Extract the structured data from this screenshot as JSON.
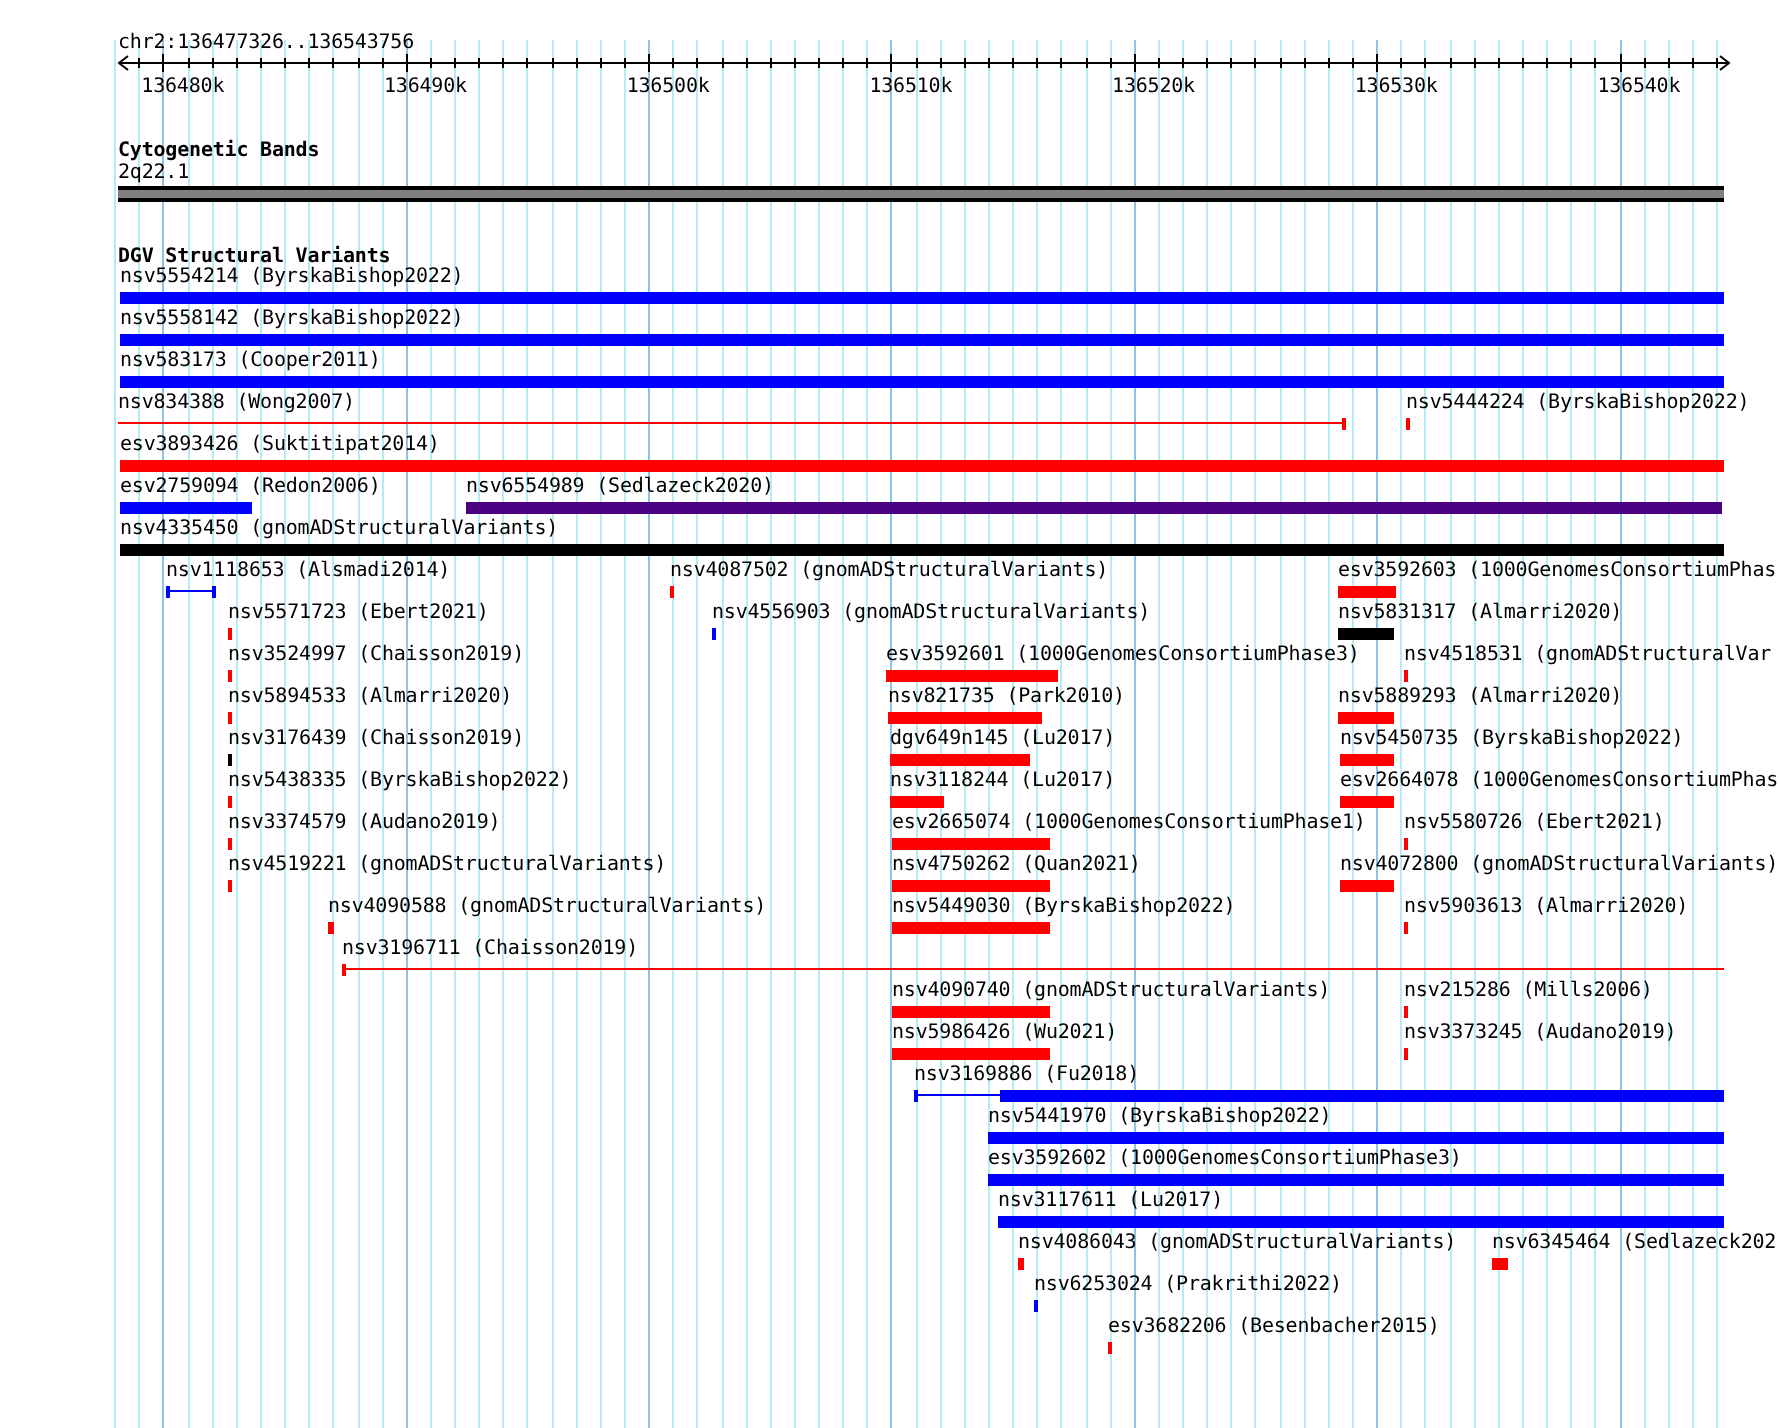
{
  "ruler": {
    "position": "chr2:136477326..136543756",
    "ticks": [
      "136480k",
      "136490k",
      "136500k",
      "136510k",
      "136520k",
      "136530k",
      "136540k"
    ]
  },
  "cytoband_track": {
    "title": "Cytogenetic Bands",
    "band": "2q22.1"
  },
  "variants_track": {
    "title": "DGV Structural Variants",
    "rows": [
      {
        "features": [
          {
            "label": "nsv5554214 (ByrskaBishop2022)",
            "kind": "block",
            "color": "#0000ff"
          }
        ]
      },
      {
        "features": [
          {
            "label": "nsv5558142 (ByrskaBishop2022)",
            "kind": "block",
            "color": "#0000ff"
          }
        ]
      },
      {
        "features": [
          {
            "label": "nsv583173 (Cooper2011)",
            "kind": "block",
            "color": "#0000ff"
          }
        ]
      },
      {
        "features": [
          {
            "label": "nsv834388 (Wong2007)",
            "kind": "line",
            "color": "#ff0000"
          },
          {
            "label": "nsv5444224 (ByrskaBishop2022)",
            "kind": "block",
            "color": "#ff0000"
          }
        ]
      },
      {
        "features": [
          {
            "label": "esv3893426 (Suktitipat2014)",
            "kind": "block",
            "color": "#ff0000"
          }
        ]
      },
      {
        "features": [
          {
            "label": "esv2759094 (Redon2006)",
            "kind": "block",
            "color": "#0000ff"
          },
          {
            "label": "nsv6554989 (Sedlazeck2020)",
            "kind": "block",
            "color": "#4b0082"
          }
        ]
      },
      {
        "features": [
          {
            "label": "nsv4335450 (gnomADStructuralVariants)",
            "kind": "block",
            "color": "#000000"
          }
        ]
      },
      {
        "features": [
          {
            "label": "nsv1118653 (Alsmadi2014)",
            "kind": "line",
            "color": "#0000ff"
          },
          {
            "label": "nsv4087502 (gnomADStructuralVariants)",
            "kind": "block",
            "color": "#ff0000"
          },
          {
            "label": "esv3592603 (1000GenomesConsortiumPhas",
            "kind": "block",
            "color": "#ff0000"
          }
        ]
      },
      {
        "features": [
          {
            "label": "nsv5571723 (Ebert2021)",
            "kind": "block",
            "color": "#ff0000"
          },
          {
            "label": "nsv4556903 (gnomADStructuralVariants)",
            "kind": "block",
            "color": "#0000ff"
          },
          {
            "label": "nsv5831317 (Almarri2020)",
            "kind": "block",
            "color": "#000000"
          }
        ]
      },
      {
        "features": [
          {
            "label": "nsv3524997 (Chaisson2019)",
            "kind": "block",
            "color": "#ff0000"
          },
          {
            "label": "esv3592601 (1000GenomesConsortiumPhase3)",
            "kind": "block",
            "color": "#ff0000"
          },
          {
            "label": "nsv4518531 (gnomADStructuralVar",
            "kind": "block",
            "color": "#ff0000"
          }
        ]
      },
      {
        "features": [
          {
            "label": "nsv5894533 (Almarri2020)",
            "kind": "block",
            "color": "#ff0000"
          },
          {
            "label": "nsv821735 (Park2010)",
            "kind": "block",
            "color": "#ff0000"
          },
          {
            "label": "nsv5889293 (Almarri2020)",
            "kind": "block",
            "color": "#ff0000"
          }
        ]
      },
      {
        "features": [
          {
            "label": "nsv3176439 (Chaisson2019)",
            "kind": "block",
            "color": "#000000"
          },
          {
            "label": "dgv649n145 (Lu2017)",
            "kind": "block",
            "color": "#ff0000"
          },
          {
            "label": "nsv5450735 (ByrskaBishop2022)",
            "kind": "block",
            "color": "#ff0000"
          }
        ]
      },
      {
        "features": [
          {
            "label": "nsv5438335 (ByrskaBishop2022)",
            "kind": "block",
            "color": "#ff0000"
          },
          {
            "label": "nsv3118244 (Lu2017)",
            "kind": "block",
            "color": "#ff0000"
          },
          {
            "label": "esv2664078 (1000GenomesConsortiumPhas",
            "kind": "block",
            "color": "#ff0000"
          }
        ]
      },
      {
        "features": [
          {
            "label": "nsv3374579 (Audano2019)",
            "kind": "block",
            "color": "#ff0000"
          },
          {
            "label": "esv2665074 (1000GenomesConsortiumPhase1)",
            "kind": "block",
            "color": "#ff0000"
          },
          {
            "label": "nsv5580726 (Ebert2021)",
            "kind": "block",
            "color": "#ff0000"
          }
        ]
      },
      {
        "features": [
          {
            "label": "nsv4519221 (gnomADStructuralVariants)",
            "kind": "block",
            "color": "#ff0000"
          },
          {
            "label": "nsv4750262 (Quan2021)",
            "kind": "block",
            "color": "#ff0000"
          },
          {
            "label": "nsv4072800 (gnomADStructuralVariants)",
            "kind": "block",
            "color": "#ff0000"
          }
        ]
      },
      {
        "features": [
          {
            "label": "nsv4090588 (gnomADStructuralVariants)",
            "kind": "block",
            "color": "#ff0000"
          },
          {
            "label": "nsv5449030 (ByrskaBishop2022)",
            "kind": "block",
            "color": "#ff0000"
          },
          {
            "label": "nsv5903613 (Almarri2020)",
            "kind": "block",
            "color": "#ff0000"
          }
        ]
      },
      {
        "features": [
          {
            "label": "nsv3196711 (Chaisson2019)",
            "kind": "line",
            "color": "#ff0000"
          }
        ]
      },
      {
        "features": [
          {
            "label": "nsv4090740 (gnomADStructuralVariants)",
            "kind": "block",
            "color": "#ff0000"
          },
          {
            "label": "nsv215286 (Mills2006)",
            "kind": "block",
            "color": "#ff0000"
          }
        ]
      },
      {
        "features": [
          {
            "label": "nsv5986426 (Wu2021)",
            "kind": "block",
            "color": "#ff0000"
          },
          {
            "label": "nsv3373245 (Audano2019)",
            "kind": "block",
            "color": "#ff0000"
          }
        ]
      },
      {
        "features": [
          {
            "label": "nsv3169886 (Fu2018)",
            "kind": "tailed",
            "color": "#0000ff"
          }
        ]
      },
      {
        "features": [
          {
            "label": "nsv5441970 (ByrskaBishop2022)",
            "kind": "block",
            "color": "#0000ff"
          }
        ]
      },
      {
        "features": [
          {
            "label": "esv3592602 (1000GenomesConsortiumPhase3)",
            "kind": "block",
            "color": "#0000ff"
          }
        ]
      },
      {
        "features": [
          {
            "label": "nsv3117611 (Lu2017)",
            "kind": "block",
            "color": "#0000ff"
          }
        ]
      },
      {
        "features": [
          {
            "label": "nsv4086043 (gnomADStructuralVariants)",
            "kind": "block",
            "color": "#ff0000"
          },
          {
            "label": "nsv6345464 (Sedlazeck202",
            "kind": "block",
            "color": "#ff0000"
          }
        ]
      },
      {
        "features": [
          {
            "label": "nsv6253024 (Prakrithi2022)",
            "kind": "block",
            "color": "#0000ff"
          }
        ]
      },
      {
        "features": [
          {
            "label": "esv3682206 (Besenbacher2015)",
            "kind": "block",
            "color": "#ff0000"
          }
        ]
      }
    ]
  }
}
